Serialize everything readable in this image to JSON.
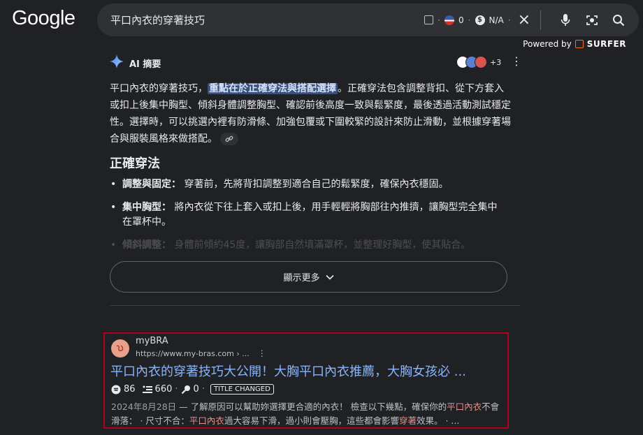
{
  "logo": "Google",
  "search": {
    "query": "平口內衣的穿著技巧",
    "zero_count": "0",
    "na_label": "N/A",
    "dot": "·"
  },
  "powered": {
    "text": "Powered by",
    "brand": "SURFER"
  },
  "ai_overview": {
    "title": "AI 摘要",
    "source_more": "+3",
    "intro_a": "平口內衣的穿著技巧，",
    "intro_highlight": "重點在於正確穿法與搭配選擇",
    "intro_b": "。正確穿法包含調整背扣、從下方套入或扣上後集中胸型、傾斜身體調整胸型、確認前後高度一致與鬆緊度，最後透過活動測試穩定性。選擇時，可以挑選內裡有防滑條、加強包覆或下圍較緊的設計來防止滑動，並根據穿著場合與服裝風格來做搭配。",
    "section_title": "正確穿法",
    "bullets": [
      {
        "term": "調整與固定：",
        "text": " 穿著前，先將背扣調整到適合自己的鬆緊度，確保內衣穩固。"
      },
      {
        "term": "集中胸型：",
        "text": " 將內衣從下往上套入或扣上後，用手輕輕將胸部往內推擠，讓胸型完全集中在罩杯中。"
      },
      {
        "term": "傾斜調整：",
        "text": " 身體前傾約45度，讓胸部自然填滿罩杯，並整理好胸型，使其貼合。"
      }
    ],
    "show_more": "顯示更多"
  },
  "result": {
    "site_name": "myBRA",
    "url": "https://www.my-bras.com › ...",
    "title": "平口內衣的穿著技巧大公開！大胸平口內衣推薦，大胸女孩必 ...",
    "metric_a": "86",
    "metric_b": "660",
    "metric_c": "0",
    "badge": "TITLE CHANGED",
    "date": "2024年8月28日",
    "snippet_1": " — 了解原因可以幫助妳選擇更合適的內衣！ 檢查以下幾點，確保你的",
    "snippet_em1": "平口內衣",
    "snippet_2": "不會滑落： · 尺寸不合：",
    "snippet_em2": "平口內衣",
    "snippet_3": "過大容易下滑，過小則會壓胸，這些都會影響",
    "snippet_em3": "穿著",
    "snippet_4": "效果。 · ..."
  },
  "colors": {
    "background": "#202124",
    "link": "#8ab4f8",
    "highlight_red": "#f28b82",
    "result_border": "#b3001b"
  }
}
